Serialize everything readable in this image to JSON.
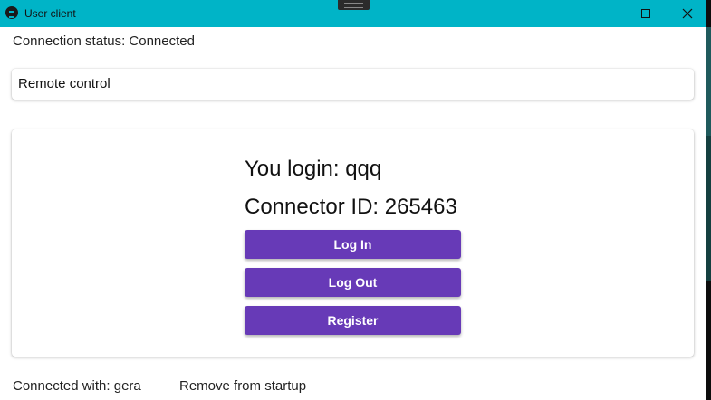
{
  "window": {
    "title": "User client",
    "minimize_icon": "minimize-icon",
    "maximize_icon": "maximize-icon",
    "close_icon": "close-icon"
  },
  "status": {
    "text": "Connection status: Connected"
  },
  "remote": {
    "label": "Remote control"
  },
  "main": {
    "login_text": "You login: qqq",
    "connector_text": "Connector ID: 265463",
    "login_button": "Log In",
    "logout_button": "Log Out",
    "register_button": "Register",
    "button_color": "#673ab7"
  },
  "footer": {
    "connected_with": "Connected with: gera",
    "remove_startup": "Remove from startup"
  },
  "colors": {
    "titlebar": "#00b4c7",
    "accent": "#673ab7"
  }
}
